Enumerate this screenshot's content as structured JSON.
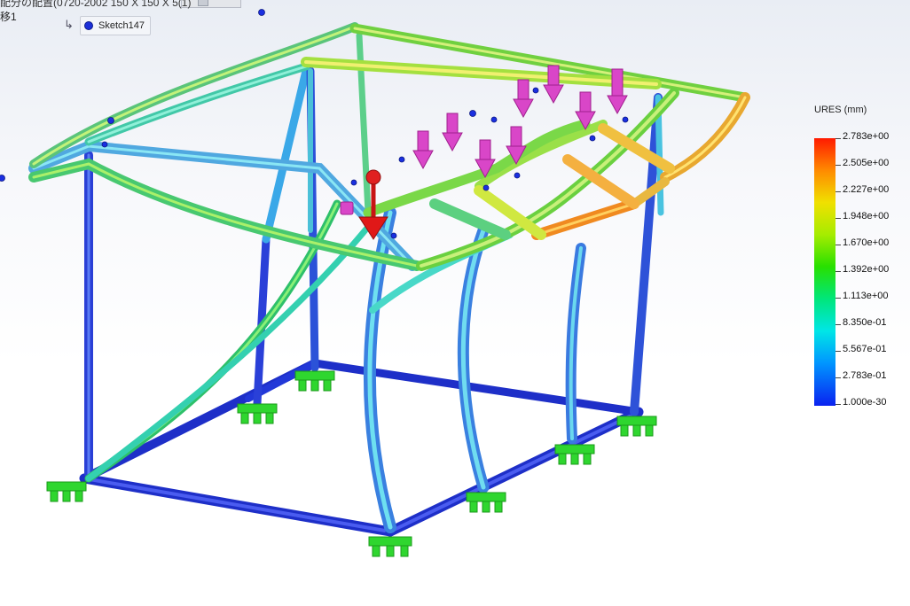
{
  "header": {
    "title_fragment": "配分の配置(0720-2002 150 X 150 X 5(1)",
    "sub_label": "移1"
  },
  "tree": {
    "sketch_label": "Sketch147"
  },
  "legend": {
    "title": "URES (mm)",
    "labels": [
      "2.783e+00",
      "2.505e+00",
      "2.227e+00",
      "1.948e+00",
      "1.670e+00",
      "1.392e+00",
      "1.113e+00",
      "8.350e-01",
      "5.567e-01",
      "2.783e-01",
      "1.000e-30"
    ],
    "max_value": 2.783,
    "min_value": 1e-30,
    "colors": [
      "#ff1a00",
      "#ff8a00",
      "#f0e000",
      "#a6ec00",
      "#28e000",
      "#00e67a",
      "#00e6e6",
      "#0096ff",
      "#0a22f0"
    ]
  },
  "model": {
    "load_arrow_color": "#d946c8",
    "force_arrow_color": "#e01818",
    "fixture_color": "#2fd62f",
    "point_color": "#1a2fe0"
  }
}
